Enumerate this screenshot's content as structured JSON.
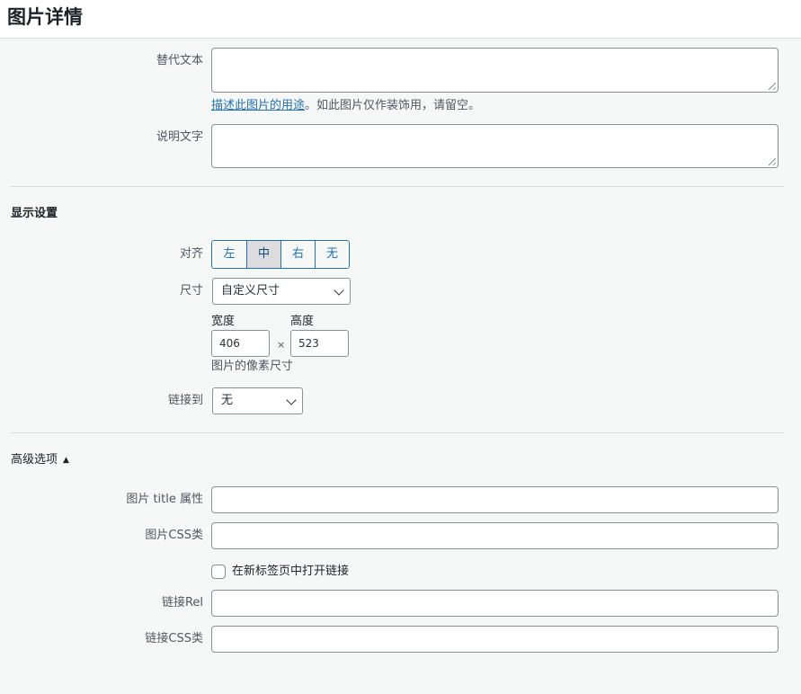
{
  "header": {
    "title": "图片详情"
  },
  "alt_text": {
    "label": "替代文本",
    "value": "",
    "hint_link": "描述此图片的用途",
    "hint_rest": "。如此图片仅作装饰用，请留空。"
  },
  "caption": {
    "label": "说明文字",
    "value": ""
  },
  "display": {
    "section_title": "显示设置",
    "align": {
      "label": "对齐",
      "options": [
        "左",
        "中",
        "右",
        "无"
      ],
      "selected": "中"
    },
    "size": {
      "label": "尺寸",
      "value": "自定义尺寸"
    },
    "width": {
      "label": "宽度",
      "value": "406"
    },
    "height": {
      "label": "高度",
      "value": "523"
    },
    "times": "×",
    "px_note": "图片的像素尺寸",
    "link_to": {
      "label": "链接到",
      "value": "无"
    }
  },
  "advanced": {
    "title": "高级选项",
    "toggle_icon": "▲",
    "image_title": {
      "label": "图片 title 属性",
      "value": ""
    },
    "image_css": {
      "label": "图片CSS类",
      "value": ""
    },
    "new_tab": {
      "label": "在新标签页中打开链接",
      "checked": false
    },
    "link_rel": {
      "label": "链接Rel",
      "value": ""
    },
    "link_css": {
      "label": "链接CSS类",
      "value": ""
    }
  },
  "colors": {
    "accent": "#2271b1",
    "background": "#f6f7f7",
    "border": "#8c8f94"
  }
}
